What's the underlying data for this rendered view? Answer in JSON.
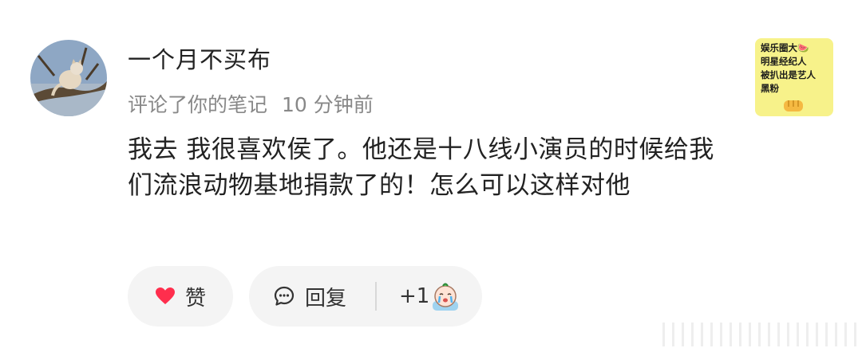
{
  "comment_card": {
    "username": "一个月不买布",
    "action": "评论了你的笔记",
    "time": "10 分钟前",
    "text": "我去 我很喜欢侯了。他还是十八线小演员的时候给我们流浪动物基地捐款了的！怎么可以这样对他",
    "avatar_icon": "cat-on-tree-avatar"
  },
  "note_thumbnail": {
    "text": "娱乐圈大🍉\n明星经纪人\n被扒出是艺人\n黑粉",
    "background": "#f7f28a",
    "icon": "fist-emoji-icon"
  },
  "actions": {
    "like_label": "赞",
    "reply_label": "回复",
    "reaction_count": "+1",
    "like_icon": "heart-icon",
    "reply_icon": "comment-bubble-icon",
    "reaction_icon": "crying-sticker-icon",
    "like_color": "#ff2e4d"
  }
}
